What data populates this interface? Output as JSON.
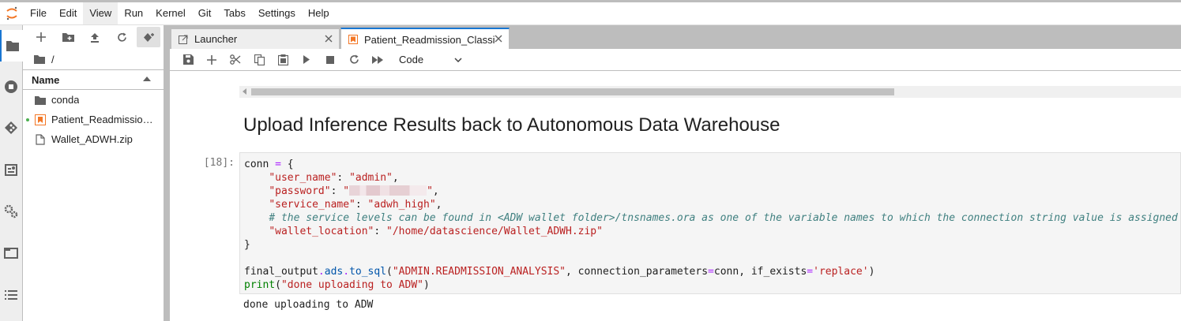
{
  "menubar": {
    "items": [
      "File",
      "Edit",
      "View",
      "Run",
      "Kernel",
      "Git",
      "Tabs",
      "Settings",
      "Help"
    ],
    "active": "View"
  },
  "filebrowser": {
    "breadcrumb": "/",
    "column_header": "Name",
    "files": [
      {
        "name": "conda",
        "icon": "folder-icon"
      },
      {
        "name": "Patient_Readmission_Classification.ipynb",
        "icon": "notebook-icon",
        "running": true
      },
      {
        "name": "Wallet_ADWH.zip",
        "icon": "file-icon"
      }
    ]
  },
  "tabs": [
    {
      "label": "Launcher",
      "icon": "launcher-icon",
      "active": false
    },
    {
      "label": "Patient_Readmission_Classification.ipynb",
      "icon": "notebook-icon",
      "active": true
    }
  ],
  "notebook_toolbar": {
    "cell_type": "Code"
  },
  "notebook": {
    "heading": "Upload Inference Results back to Autonomous Data Warehouse",
    "cell_prompt": "[18]:",
    "code": {
      "line1_var": "conn",
      "line1_rest": " {",
      "k_user": "\"user_name\"",
      "v_user": "\"admin\"",
      "k_pass": "\"password\"",
      "k_service": "\"service_name\"",
      "v_service": "\"adwh_high\"",
      "comment": "# the service levels can be found in <ADW wallet folder>/tnsnames.ora as one of the variable names to which the connection string value is assigned",
      "k_wallet": "\"wallet_location\"",
      "v_wallet": "\"/home/datascience/Wallet_ADWH.zip\"",
      "close": "}",
      "l2_obj": "final_output",
      "l2_attr": "ads",
      "l2_fn": "to_sql",
      "l2_arg1": "\"ADMIN.READMISSION_ANALYSIS\"",
      "l2_p1": "connection_parameters",
      "l2_v1": "conn",
      "l2_p2": "if_exists",
      "l2_v2": "'replace'",
      "l3_fn": "print",
      "l3_arg": "\"done uploading to ADW\""
    },
    "output": "done uploading to ADW"
  },
  "colors": {
    "accent": "#1976d2",
    "notebook_orange": "#f37726",
    "running_dot": "#4caf50"
  }
}
